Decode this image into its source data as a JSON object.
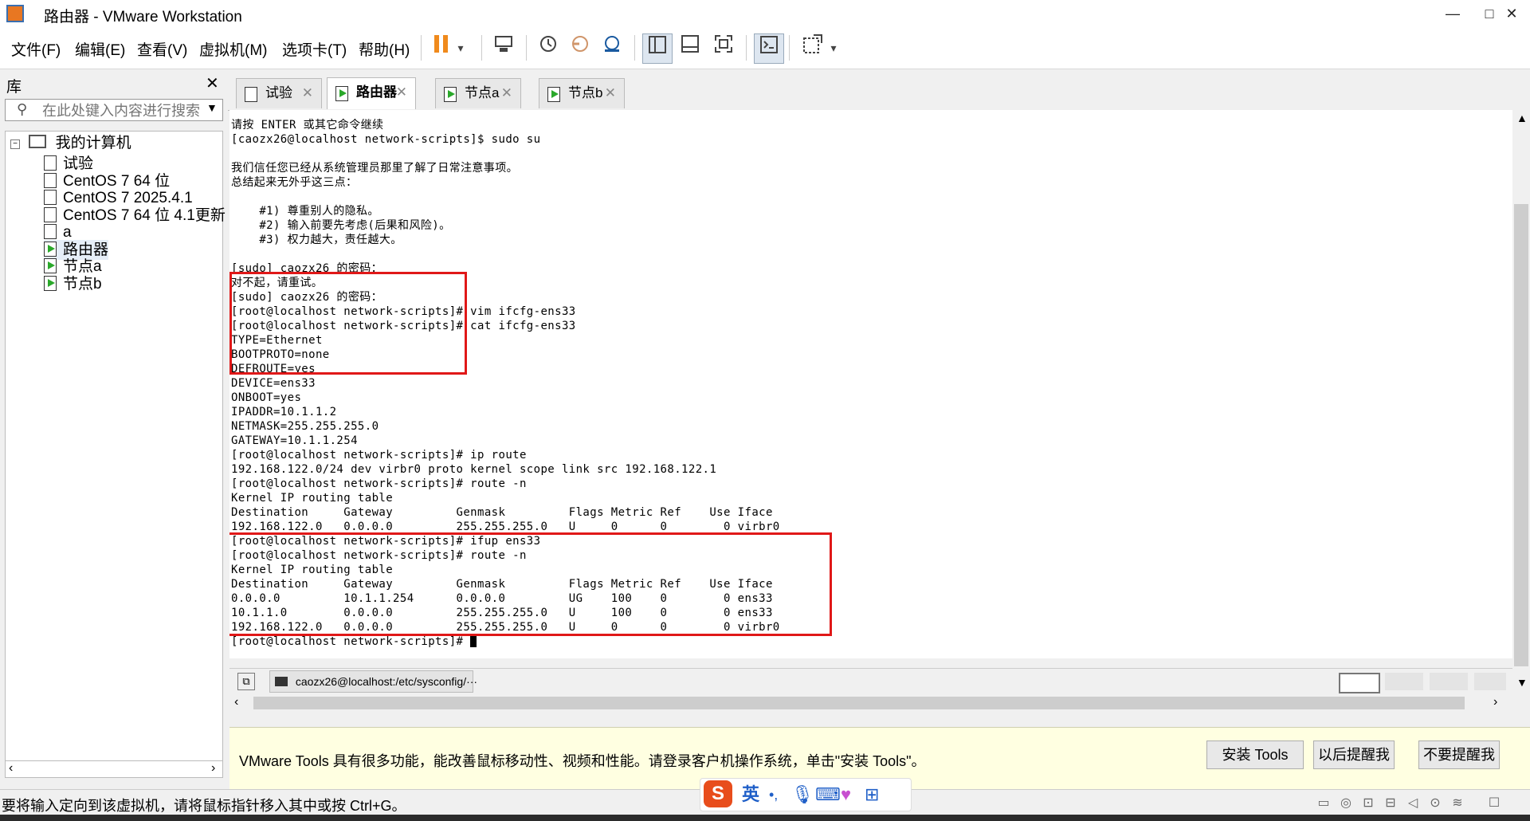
{
  "window": {
    "title": "路由器 - VMware Workstation",
    "minimize": "—",
    "maximize": "□",
    "close": "✕"
  },
  "menu": [
    "文件(F)",
    "编辑(E)",
    "查看(V)",
    "虚拟机(M)",
    "选项卡(T)",
    "帮助(H)"
  ],
  "library": {
    "title": "库",
    "close": "✕",
    "search_placeholder": "在此处键入内容进行搜索",
    "root": "我的计算机",
    "items": [
      {
        "label": "试验",
        "running": false
      },
      {
        "label": "CentOS 7 64 位",
        "running": false
      },
      {
        "label": "CentOS 7 2025.4.1",
        "running": false
      },
      {
        "label": "CentOS 7 64 位 4.1更新",
        "running": false
      },
      {
        "label": "a",
        "running": false
      },
      {
        "label": "路由器",
        "running": true
      },
      {
        "label": "节点a",
        "running": true
      },
      {
        "label": "节点b",
        "running": true
      }
    ]
  },
  "tabs": [
    {
      "label": "试验",
      "active": false
    },
    {
      "label": "路由器",
      "active": true
    },
    {
      "label": "节点a",
      "active": false
    },
    {
      "label": "节点b",
      "active": false
    }
  ],
  "console": {
    "lines": [
      "请按 ENTER 或其它命令继续",
      "[caozx26@localhost network-scripts]$ sudo su",
      "",
      "我们信任您已经从系统管理员那里了解了日常注意事项。",
      "总结起来无外乎这三点：",
      "",
      "    #1) 尊重别人的隐私。",
      "    #2) 输入前要先考虑(后果和风险)。",
      "    #3) 权力越大，责任越大。",
      "",
      "[sudo] caozx26 的密码：",
      "对不起，请重试。",
      "[sudo] caozx26 的密码：",
      "[root@localhost network-scripts]# vim ifcfg-ens33",
      "[root@localhost network-scripts]# cat ifcfg-ens33",
      "TYPE=Ethernet",
      "BOOTPROTO=none",
      "DEFROUTE=yes",
      "DEVICE=ens33",
      "ONBOOT=yes",
      "IPADDR=10.1.1.2",
      "NETMASK=255.255.255.0",
      "GATEWAY=10.1.1.254",
      "[root@localhost network-scripts]# ip route",
      "192.168.122.0/24 dev virbr0 proto kernel scope link src 192.168.122.1",
      "[root@localhost network-scripts]# route -n",
      "Kernel IP routing table",
      "Destination     Gateway         Genmask         Flags Metric Ref    Use Iface",
      "192.168.122.0   0.0.0.0         255.255.255.0   U     0      0        0 virbr0",
      "[root@localhost network-scripts]# ifup ens33",
      "[root@localhost network-scripts]# route -n",
      "Kernel IP routing table",
      "Destination     Gateway         Genmask         Flags Metric Ref    Use Iface",
      "0.0.0.0         10.1.1.254      0.0.0.0         UG    100    0        0 ens33",
      "10.1.1.0        0.0.0.0         255.255.255.0   U     100    0        0 ens33",
      "192.168.122.0   0.0.0.0         255.255.255.0   U     0      0        0 virbr0"
    ],
    "prompt": "[root@localhost network-scripts]# ",
    "taskbar_item": "caozx26@localhost:/etc/sysconfig/···",
    "highlight_color": "#e01818"
  },
  "tools_notice": {
    "text": "VMware Tools 具有很多功能，能改善鼠标移动性、视频和性能。请登录客户机操作系统，单击\"安装 Tools\"。",
    "install": "安装 Tools",
    "remind_later": "以后提醒我",
    "never_remind": "不要提醒我"
  },
  "status": {
    "text": "要将输入定向到该虚拟机，请将鼠标指针移入其中或按 Ctrl+G。",
    "ime_lang": "英",
    "ime_punct": "•,"
  },
  "colors": {
    "accent": "#e87722",
    "pause": "#f08a1c",
    "running": "#2aa82a"
  }
}
